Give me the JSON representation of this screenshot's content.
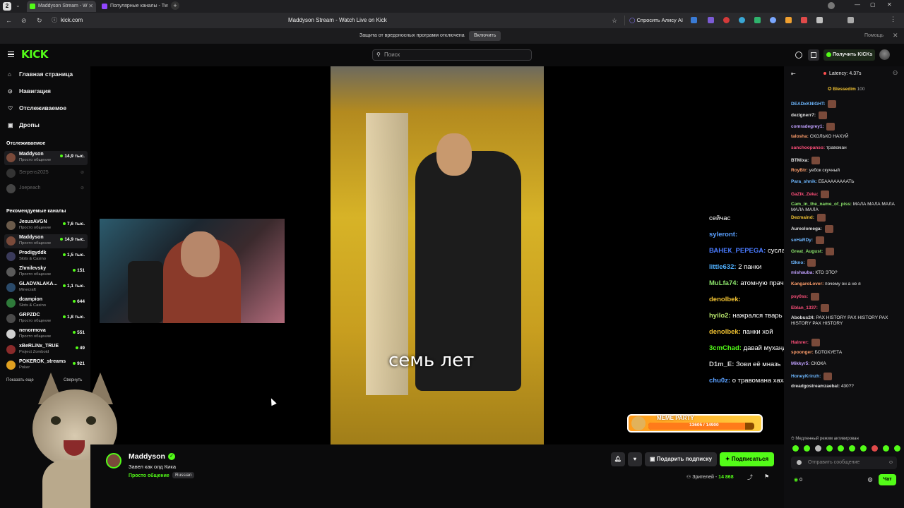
{
  "browser": {
    "tabs": [
      {
        "label": "Maddyson Stream - W"
      },
      {
        "label": "Популярные каналы - Tw"
      }
    ],
    "url": "kick.com",
    "page_title": "Maddyson Stream - Watch Live on Kick",
    "alice": "Спросить Алису AI",
    "info_text": "Защита от вредоносных программ отключена",
    "info_button": "Включить",
    "help": "Помощь"
  },
  "header": {
    "logo": "KICK",
    "search_placeholder": "Поиск",
    "get_kicks": "Получить KICKs"
  },
  "sidebar": {
    "nav": [
      {
        "label": "Главная страница",
        "icon": "home-icon"
      },
      {
        "label": "Навигация",
        "icon": "compass-icon"
      },
      {
        "label": "Отслеживаемое",
        "icon": "heart-icon"
      },
      {
        "label": "Дропы",
        "icon": "gift-icon"
      }
    ],
    "following_title": "Отслеживаемое",
    "following": [
      {
        "name": "Maddyson",
        "category": "Просто общение",
        "viewers": "14,9 тыс."
      },
      {
        "name": "Serpens2025",
        "category": "",
        "viewers": ""
      },
      {
        "name": "Joepeach",
        "category": "",
        "viewers": ""
      }
    ],
    "recommended_title": "Рекомендуемые каналы",
    "recommended": [
      {
        "name": "JesusAVGN",
        "category": "Просто общение",
        "viewers": "7,6 тыс."
      },
      {
        "name": "Maddyson",
        "category": "Просто общение",
        "viewers": "14,9 тыс."
      },
      {
        "name": "Prodigyddk",
        "category": "Slots & Casino",
        "viewers": "1,5 тыс."
      },
      {
        "name": "Zhmilevsky",
        "category": "Просто общение",
        "viewers": "151"
      },
      {
        "name": "GLADVALAKA...",
        "category": "Minecraft",
        "viewers": "1,1 тыс."
      },
      {
        "name": "dcampion",
        "category": "Slots & Casino",
        "viewers": "644"
      },
      {
        "name": "GRPZDC",
        "category": "Просто общение",
        "viewers": "1,8 тыс."
      },
      {
        "name": "nenormova",
        "category": "Просто общение",
        "viewers": "551"
      },
      {
        "name": "xBeRLiNx_TRUE",
        "category": "Project Zomboid",
        "viewers": "49"
      },
      {
        "name": "POKEROK_streams",
        "category": "Poker",
        "viewers": "921"
      }
    ],
    "show_more": "Показать еще",
    "collapse": "Свернуть"
  },
  "video": {
    "subtitle": "семь лет"
  },
  "overlay_chat": [
    {
      "user": "",
      "text": "сейчас",
      "color": "#ffffff"
    },
    {
      "user": "syleront:",
      "text": "",
      "color": "#5aa0ff"
    },
    {
      "user": "ВАНЕК_PEPEGA:",
      "text": "суслан Русачев",
      "color": "#4a7bff"
    },
    {
      "user": "little632:",
      "text": "2 панки",
      "color": "#4fb0ff"
    },
    {
      "user": "MuLfa74:",
      "text": "атомную прачечную ебашишь?",
      "color": "#8be36b"
    },
    {
      "user": "denolbek:",
      "text": "",
      "color": "#f1c232"
    },
    {
      "user": "hyilo2:",
      "text": "нажрался тварь",
      "color": "#b6e36b"
    },
    {
      "user": "denolbek:",
      "text": "панки хой",
      "color": "#f1c232"
    },
    {
      "user": "3cmChad:",
      "text": "давай муханджана в пивник",
      "color": "#53fc18"
    },
    {
      "user": "D1m_E:",
      "text": "Зови её мназь",
      "color": "#cfcfcf"
    },
    {
      "user": "chu0z:",
      "text": "о травомана хахахахахаха",
      "color": "#5aa0ff"
    }
  ],
  "meme_party": {
    "label": "MEME PARTY",
    "progress_text": "13605 / 14900",
    "progress": 0.913
  },
  "streamer": {
    "name": "Maddyson",
    "title": "Завел как олд Кика",
    "category": "Просто общение",
    "language": "Russian",
    "viewers_label": "Зрителей -",
    "viewers": "14 868"
  },
  "actions": {
    "gift": "Подарить подписку",
    "subscribe": "Подписаться"
  },
  "chat": {
    "latency": "Latency: 4.37s",
    "pinned_user": "Blessedim",
    "pinned_count": "100",
    "messages": [
      {
        "user": "DEADxKNIGHT:",
        "text": "",
        "color": "#6db7ff",
        "emote": true
      },
      {
        "user": "dezignerr7:",
        "text": "",
        "color": "#e0e0e0",
        "emote": true
      },
      {
        "user": "comradegrey1:",
        "text": "",
        "color": "#c0a0ff",
        "emote": true
      },
      {
        "user": "talosha:",
        "text": "СКОЛЬКО НАХУЙ",
        "color": "#ff9e6b",
        "emote": false
      },
      {
        "user": "sanchoopanso:",
        "text": "травоман",
        "color": "#ff4f7a",
        "emote": false
      },
      {
        "user": "BTMixa:",
        "text": "",
        "color": "#e0e0e0",
        "emote": true
      },
      {
        "user": "RoyBtr:",
        "text": "уебок скучный",
        "color": "#ff9e6b",
        "emote": false
      },
      {
        "user": "Para_shnik:",
        "text": "ЕБААААААААТЬ",
        "color": "#6db7ff",
        "emote": false
      },
      {
        "user": "GaZik_Zeka:",
        "text": "",
        "color": "#ff4f7a",
        "emote": true
      },
      {
        "user": "Cam_in_the_name_of_piss:",
        "text": "МАЛА МАЛА МАЛА МАЛА МАЛА",
        "color": "#8be36b",
        "emote": false
      },
      {
        "user": "Dezmaind:",
        "text": "",
        "color": "#f1c232",
        "emote": true
      },
      {
        "user": "Aureolomega:",
        "text": "",
        "color": "#e0e0e0",
        "emote": true
      },
      {
        "user": "soHaRDy:",
        "text": "",
        "color": "#6db7ff",
        "emote": true
      },
      {
        "user": "Great_August:",
        "text": "",
        "color": "#8be36b",
        "emote": true
      },
      {
        "user": "t3kno:",
        "text": "",
        "color": "#6db7ff",
        "emote": true
      },
      {
        "user": "mishauba:",
        "text": "КТО ЭТО?",
        "color": "#c0a0ff",
        "emote": false
      },
      {
        "user": "KangaroLover:",
        "text": "почему он а не я",
        "color": "#ff9e6b",
        "emote": false
      },
      {
        "user": "psy0ss:",
        "text": "",
        "color": "#ff4f7a",
        "emote": true
      },
      {
        "user": "Eblan_1337:",
        "text": "",
        "color": "#ff4f7a",
        "emote": true
      },
      {
        "user": "Abobus24:",
        "text": "PAX HISTORY PAX HISTORY PAX HISTORY PAX HISTORY",
        "color": "#e0e0e0",
        "emote": false
      },
      {
        "user": "Halnrer:",
        "text": "",
        "color": "#ff4f7a",
        "emote": true
      },
      {
        "user": "spoonger:",
        "text": "БОТОХУЕТА",
        "color": "#ff9e6b",
        "emote": false
      },
      {
        "user": "Mikkyr5:",
        "text": "СКОКА",
        "color": "#c0a0ff",
        "emote": false
      },
      {
        "user": "HoneyKrinzh:",
        "text": "",
        "color": "#6db7ff",
        "emote": true
      },
      {
        "user": "dreadgostreamzaebal:",
        "text": "430??",
        "color": "#e0e0e0",
        "emote": false
      }
    ],
    "slow_mode": "Медленный режим активирован",
    "input_placeholder": "Отправить сообщение",
    "points": "0",
    "send": "Чат"
  },
  "colors": {
    "brand": "#53fc18",
    "bg": "#0b0b0c"
  }
}
